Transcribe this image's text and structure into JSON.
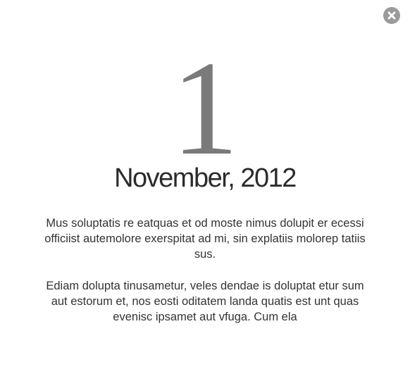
{
  "modal": {
    "close_icon": "close-icon",
    "accent_color": "#9b9b9b"
  },
  "event": {
    "day": "1",
    "month_year": "November, 2012",
    "paragraphs": [
      "Mus soluptatis re eatquas et od moste nimus dolupit er ecessi officiist autemolore exerspitat ad mi, sin explatiis molorep tatiis sus.",
      "Ediam dolupta tinusametur, veles dendae is doluptat etur sum aut estorum et, nos eosti oditatem landa quatis est unt quas evenisc ipsamet aut vfuga. Cum ela"
    ]
  }
}
